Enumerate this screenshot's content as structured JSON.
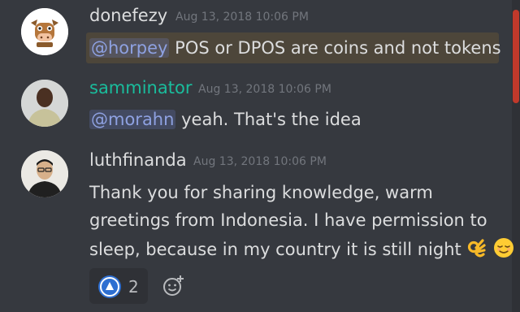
{
  "messages": [
    {
      "username": "donefezy",
      "username_color": "#b9bbbe",
      "timestamp": "Aug 13, 2018 10:06 PM",
      "mention": "@horpey",
      "text": "POS or DPOS are coins and not tokens",
      "highlighted": true
    },
    {
      "username": "samminator",
      "username_color": "#1abc9c",
      "timestamp": "Aug 13, 2018 10:06 PM",
      "mention": "@morahn",
      "text": "yeah. That's the idea"
    },
    {
      "username": "luthfinanda",
      "username_color": "#dcddde",
      "timestamp": "Aug 13, 2018 10:06 PM",
      "lines": [
        "Thank you for sharing knowledge, warm",
        "greetings from Indonesia. I have permission to",
        "sleep, because in my country it is still night"
      ],
      "emojis": [
        "ok-hand-emoji",
        "relieved-face-emoji"
      ],
      "reaction": {
        "icon": "custom-server-emoji",
        "count": "2"
      }
    }
  ],
  "colors": {
    "background": "#36393f",
    "mention": "#8ea1e1",
    "timestamp": "#72767d",
    "scrollbar_thumb": "#c0392b"
  }
}
